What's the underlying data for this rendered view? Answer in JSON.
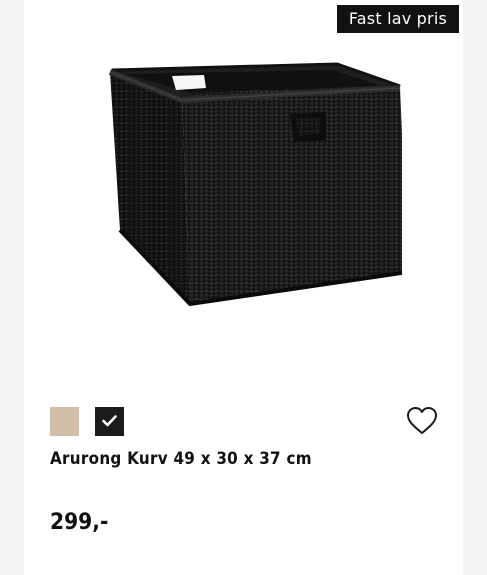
{
  "product": {
    "badge": "Fast lav pris",
    "title": "Arurong Kurv 49 x 30 x 37 cm",
    "price": "299,-",
    "image_icon": "wicker-basket-image",
    "swatches": [
      {
        "color_name": "beige",
        "hex": "#d2bfaa",
        "selected": false
      },
      {
        "color_name": "black",
        "hex": "#1a1a1a",
        "selected": true
      }
    ],
    "favorite_icon": "heart-outline-icon"
  },
  "colors": {
    "page_bg": "#f3f3f1",
    "card_bg": "#ffffff",
    "text": "#111111",
    "badge_bg": "#111111"
  }
}
